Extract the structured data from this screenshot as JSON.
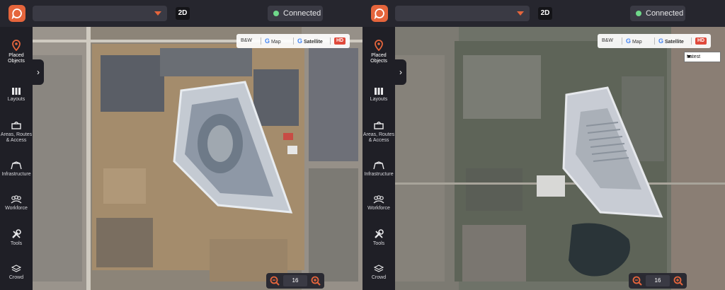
{
  "toolbar": {
    "mode_label": "2D",
    "status_label": "Connected",
    "status_color": "#6fd88a",
    "accent_color": "#e5653c"
  },
  "sidebar": {
    "items": [
      {
        "label": "Placed Objects",
        "icon": "map-pin-icon",
        "active": true
      },
      {
        "label": "Layouts",
        "icon": "layouts-icon"
      },
      {
        "label": "Areas, Routes & Access",
        "icon": "route-icon"
      },
      {
        "label": "Infrastructure",
        "icon": "tent-icon"
      },
      {
        "label": "Workforce",
        "icon": "people-icon"
      },
      {
        "label": "Tools",
        "icon": "tools-icon"
      },
      {
        "label": "Crowd",
        "icon": "crowd-icon"
      }
    ]
  },
  "map": {
    "types": [
      "B&W",
      "Map",
      "Satellite"
    ],
    "hd_label": "HD",
    "zoom_level": "16",
    "date_select": "Latest"
  }
}
